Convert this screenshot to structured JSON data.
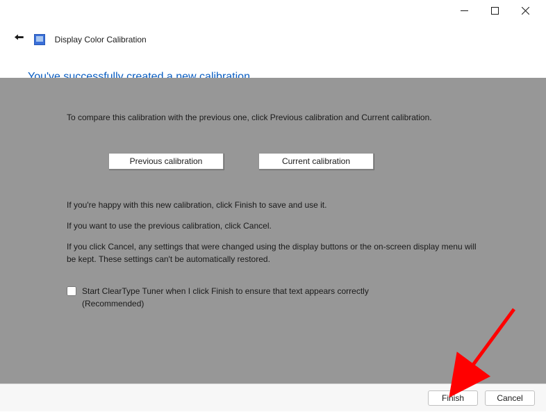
{
  "window": {
    "app_title": "Display Color Calibration"
  },
  "heading": "You've successfully created a new calibration",
  "content": {
    "intro": "To compare this calibration with the previous one, click Previous calibration and Current calibration.",
    "prev_btn": "Previous calibration",
    "curr_btn": "Current calibration",
    "line1": "If you're happy with this new calibration, click Finish to save and use it.",
    "line2": "If you want to use the previous calibration, click Cancel.",
    "line3": "If you click Cancel, any settings that were changed using the display buttons or the on-screen display menu will be kept. These settings can't be automatically restored.",
    "checkbox_label": "Start ClearType Tuner when I click Finish to ensure that text appears correctly (Recommended)"
  },
  "footer": {
    "finish": "Finish",
    "cancel": "Cancel"
  }
}
